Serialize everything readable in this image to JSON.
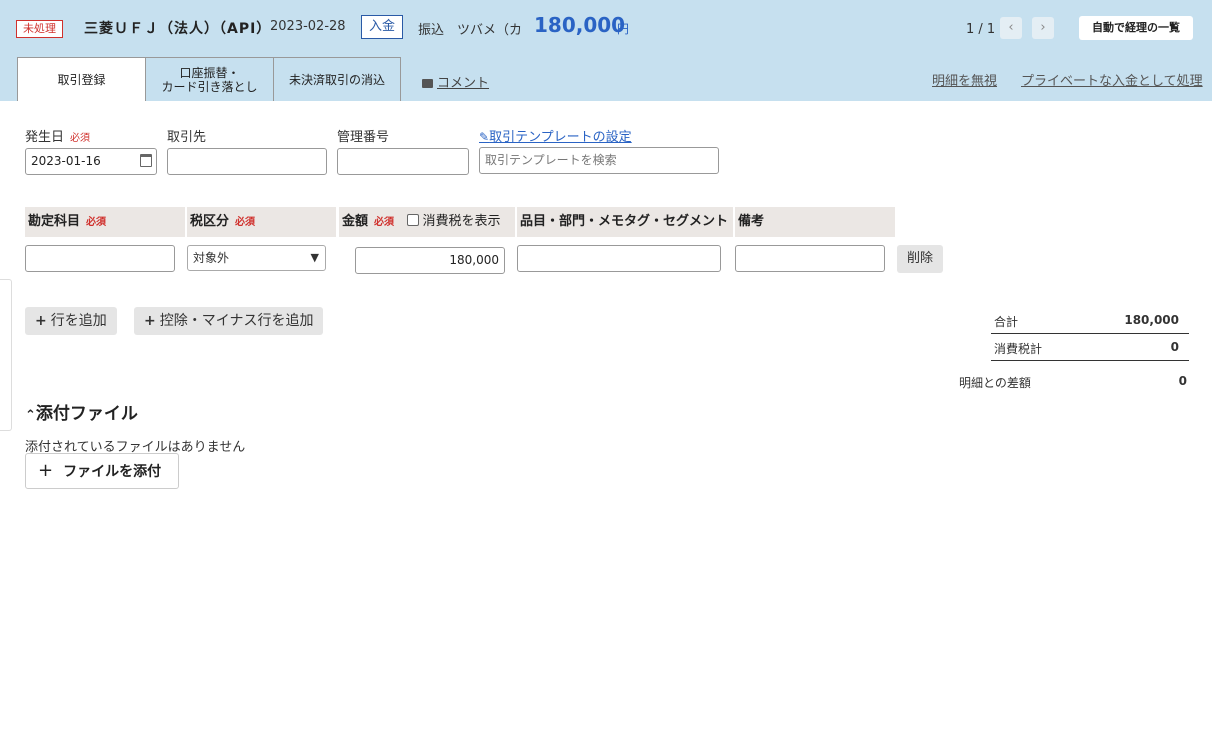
{
  "header": {
    "status": "未処理",
    "bank": "三菱ＵＦＪ（法人）（API）",
    "date": "2023-02-28",
    "type": "入金",
    "desc1": "振込",
    "desc2": "ツバメ（カ",
    "amount": "180,000",
    "currency": "円",
    "pager": "1 / 1",
    "prev_icon": "chevron-left-icon",
    "next_icon": "chevron-right-icon",
    "list_button": "自動で経理の一覧",
    "tabs": [
      {
        "label": "取引登録",
        "active": true
      },
      {
        "label": "口座振替・\nカード引き落とし",
        "active": false
      },
      {
        "label": "未決済取引の消込",
        "active": false
      }
    ],
    "comment": "コメント",
    "ignore_link": "明細を無視",
    "private_link": "プライベートな入金として処理"
  },
  "form": {
    "date_label": "発生日",
    "required": "必須",
    "date_value": "2023-01-16",
    "partner_label": "取引先",
    "mgmt_label": "管理番号",
    "template_link": "取引テンプレートの設定",
    "template_placeholder": "取引テンプレートを検索"
  },
  "table": {
    "columns": {
      "account": "勘定科目",
      "tax": "税区分",
      "amount": "金額",
      "show_tax": "消費税を表示",
      "item": "品目・部門・メモタグ・セグメント",
      "note": "備考"
    },
    "row": {
      "account": "",
      "tax": "対象外",
      "amount": "180,000",
      "item": "",
      "note": "",
      "delete": "削除"
    },
    "add_row": "行を追加",
    "add_minus_row": "控除・マイナス行を追加"
  },
  "summary": {
    "total_label": "合計",
    "total_value": "180,000",
    "tax_label": "消費税計",
    "tax_value": "0",
    "diff_label": "明細との差額",
    "diff_value": "0"
  },
  "attachments": {
    "title": "添付ファイル",
    "empty": "添付されているファイルはありません",
    "add_button": "ファイルを添付"
  }
}
